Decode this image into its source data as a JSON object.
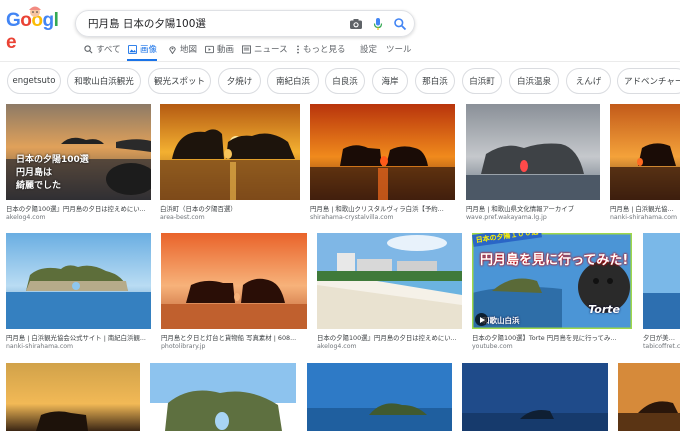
{
  "search": {
    "query": "円月島 日本の夕陽100選"
  },
  "nav": {
    "all": "すべて",
    "images": "画像",
    "maps": "地図",
    "videos": "動画",
    "news": "ニュース",
    "more": "もっと見る",
    "settings": "設定",
    "tools": "ツール"
  },
  "chips": [
    "engetsuto",
    "和歌山白浜観光",
    "観光スポット",
    "夕焼け",
    "南紀白浜",
    "白良浜",
    "海岸",
    "那白浜",
    "白浜町",
    "白浜温泉",
    "えんげ",
    "アドベンチャー"
  ],
  "results": [
    {
      "caption": "日本の夕陽100選』円月島の夕日は控えめにい...",
      "source": "akelog4.com",
      "overlay": [
        "日本の夕陽100選",
        "円月島は",
        "綺麗でした"
      ]
    },
    {
      "caption": "白浜町（日本の夕陽百選）",
      "source": "area-best.com"
    },
    {
      "caption": "円月島 | 和歌山クリスタルヴィラ白浜【予約...",
      "source": "shirahama-crystalvilla.com"
    },
    {
      "caption": "円月島 | 和歌山県文化情報アーカイブ",
      "source": "wave.pref.wakayama.lg.jp"
    },
    {
      "caption": "円月島 | 白浜観光協会公...",
      "source": "nanki-shirahama.com"
    },
    {
      "caption": "円月島 | 白浜観光協会公式サイト | 南紀白浜観...",
      "source": "nanki-shirahama.com"
    },
    {
      "caption": "円月島と夕日と灯台と貨物船 写真素材 | 608...",
      "source": "photolibrary.jp"
    },
    {
      "caption": "日本の夕陽100選』円月島の夕日は控えめにい...",
      "source": "akelog4.com"
    },
    {
      "caption": "日本の夕陽100選】Torte 円月島を見に行ってみ...",
      "source": "youtube.com",
      "banner_top": "日本の夕陽１００選",
      "banner_main": "円月島を見に行ってみた!",
      "banner_place": "和歌山白浜",
      "banner_brand": "Torte"
    },
    {
      "caption": "夕日が美しい...",
      "source": "tabicoffret.co..."
    }
  ]
}
